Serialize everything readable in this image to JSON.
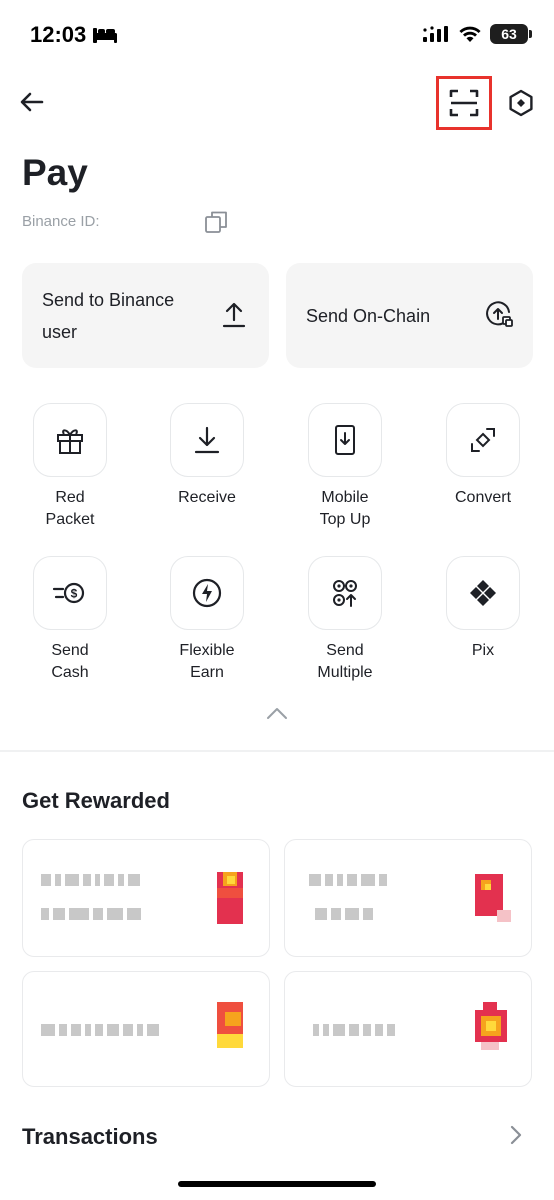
{
  "status": {
    "time": "12:03",
    "battery": "63"
  },
  "icons": {
    "back": "arrow-left-icon",
    "scan": "scan-icon",
    "settings": "hexagon-settings-icon",
    "copy": "copy-icon",
    "upload": "upload-icon",
    "send_onchain": "send-onchain-icon",
    "collapse": "chevron-up-icon",
    "chevron_right": "chevron-right-icon"
  },
  "colors": {
    "highlight": "#e8322c",
    "card_bg": "#f5f5f5",
    "text": "#1e2026",
    "muted": "#9aa0a6"
  },
  "page": {
    "title": "Pay",
    "binance_id_label": "Binance ID:"
  },
  "send": {
    "to_user": "Send to Binance\nuser",
    "on_chain": "Send On-Chain"
  },
  "actions": [
    {
      "label": "Red\nPacket",
      "icon": "gift-icon"
    },
    {
      "label": "Receive",
      "icon": "download-icon"
    },
    {
      "label": "Mobile\nTop Up",
      "icon": "mobile-topup-icon"
    },
    {
      "label": "Convert",
      "icon": "convert-icon"
    },
    {
      "label": "Send\nCash",
      "icon": "send-cash-icon"
    },
    {
      "label": "Flexible\nEarn",
      "icon": "flexible-earn-icon"
    },
    {
      "label": "Send\nMultiple",
      "icon": "send-multiple-icon"
    },
    {
      "label": "Pix",
      "icon": "pix-icon"
    }
  ],
  "rewards": {
    "title": "Get Rewarded"
  },
  "transactions": {
    "title": "Transactions"
  }
}
